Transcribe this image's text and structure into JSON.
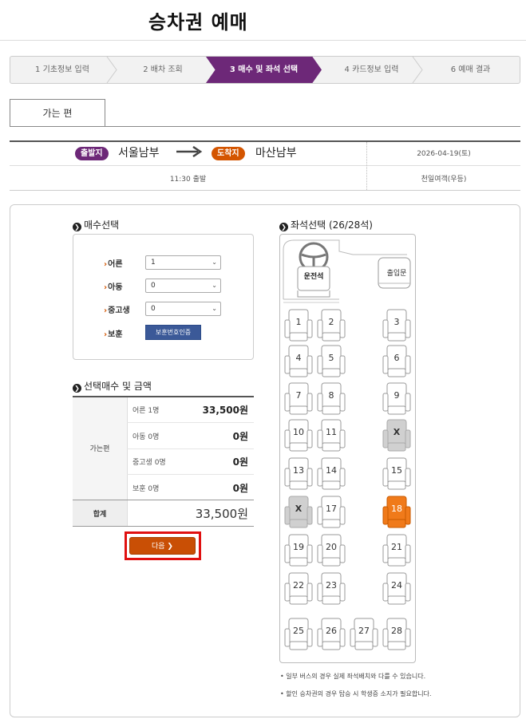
{
  "page": {
    "title": "승차권 예매"
  },
  "steps": [
    {
      "label": "1 기초정보 입력",
      "active": false
    },
    {
      "label": "2 배차 조회",
      "active": false
    },
    {
      "label": "3 매수 및 좌석 선택",
      "active": true
    },
    {
      "label": "4 카드정보 입력",
      "active": false
    },
    {
      "label": "6 예매 결과",
      "active": false
    }
  ],
  "tab": {
    "label": "가는 편"
  },
  "route": {
    "departure_badge": "출발지",
    "departure": "서울남부",
    "arrival_badge": "도착지",
    "arrival": "마산남부",
    "date": "2026-04-19(토)",
    "time": "11:30 출발",
    "bus_class": "천일여객(우등)"
  },
  "count_section": {
    "title": "매수선택",
    "rows": [
      {
        "label": "어른",
        "value": "1"
      },
      {
        "label": "아동",
        "value": "0"
      },
      {
        "label": "중고생",
        "value": "0"
      }
    ],
    "veteran_label": "보훈",
    "veteran_button": "보훈번호인증"
  },
  "summary": {
    "title": "선택매수 및 금액",
    "group_label": "가는편",
    "rows": [
      {
        "category": "어른 1명",
        "amount": "33,500원"
      },
      {
        "category": "아동 0명",
        "amount": "0원"
      },
      {
        "category": "중고생 0명",
        "amount": "0원"
      },
      {
        "category": "보훈 0명",
        "amount": "0원"
      }
    ],
    "total_label": "합계",
    "total_amount": "33,500원"
  },
  "next_button": {
    "label": "다음 ❯"
  },
  "seat_section": {
    "title": "좌석선택 (26/28석)",
    "driver_label": "운전석",
    "door_label": "출입문",
    "seats": [
      {
        "number": "1",
        "status": "available"
      },
      {
        "number": "2",
        "status": "available"
      },
      {
        "number": "3",
        "status": "available"
      },
      {
        "number": "4",
        "status": "available"
      },
      {
        "number": "5",
        "status": "available"
      },
      {
        "number": "6",
        "status": "available"
      },
      {
        "number": "7",
        "status": "available"
      },
      {
        "number": "8",
        "status": "available"
      },
      {
        "number": "9",
        "status": "available"
      },
      {
        "number": "10",
        "status": "available"
      },
      {
        "number": "11",
        "status": "available"
      },
      {
        "number": "X",
        "status": "taken"
      },
      {
        "number": "13",
        "status": "available"
      },
      {
        "number": "14",
        "status": "available"
      },
      {
        "number": "15",
        "status": "available"
      },
      {
        "number": "X",
        "status": "taken"
      },
      {
        "number": "17",
        "status": "available"
      },
      {
        "number": "18",
        "status": "selected"
      },
      {
        "number": "19",
        "status": "available"
      },
      {
        "number": "20",
        "status": "available"
      },
      {
        "number": "21",
        "status": "available"
      },
      {
        "number": "22",
        "status": "available"
      },
      {
        "number": "23",
        "status": "available"
      },
      {
        "number": "24",
        "status": "available"
      },
      {
        "number": "25",
        "status": "available"
      },
      {
        "number": "26",
        "status": "available"
      },
      {
        "number": "27",
        "status": "available"
      },
      {
        "number": "28",
        "status": "available"
      }
    ]
  },
  "notes": [
    "일부 버스의 경우 실제 좌석배치와 다를 수 있습니다.",
    "할인 승차권의 경우 탑승 시 학생증 소지가 필요합니다."
  ],
  "colors": {
    "primary": "#6d2878",
    "accent": "#d45500",
    "selected_seat": "#f07a1a",
    "taken_seat": "#d0d0d0",
    "highlight_frame": "#e01010"
  }
}
